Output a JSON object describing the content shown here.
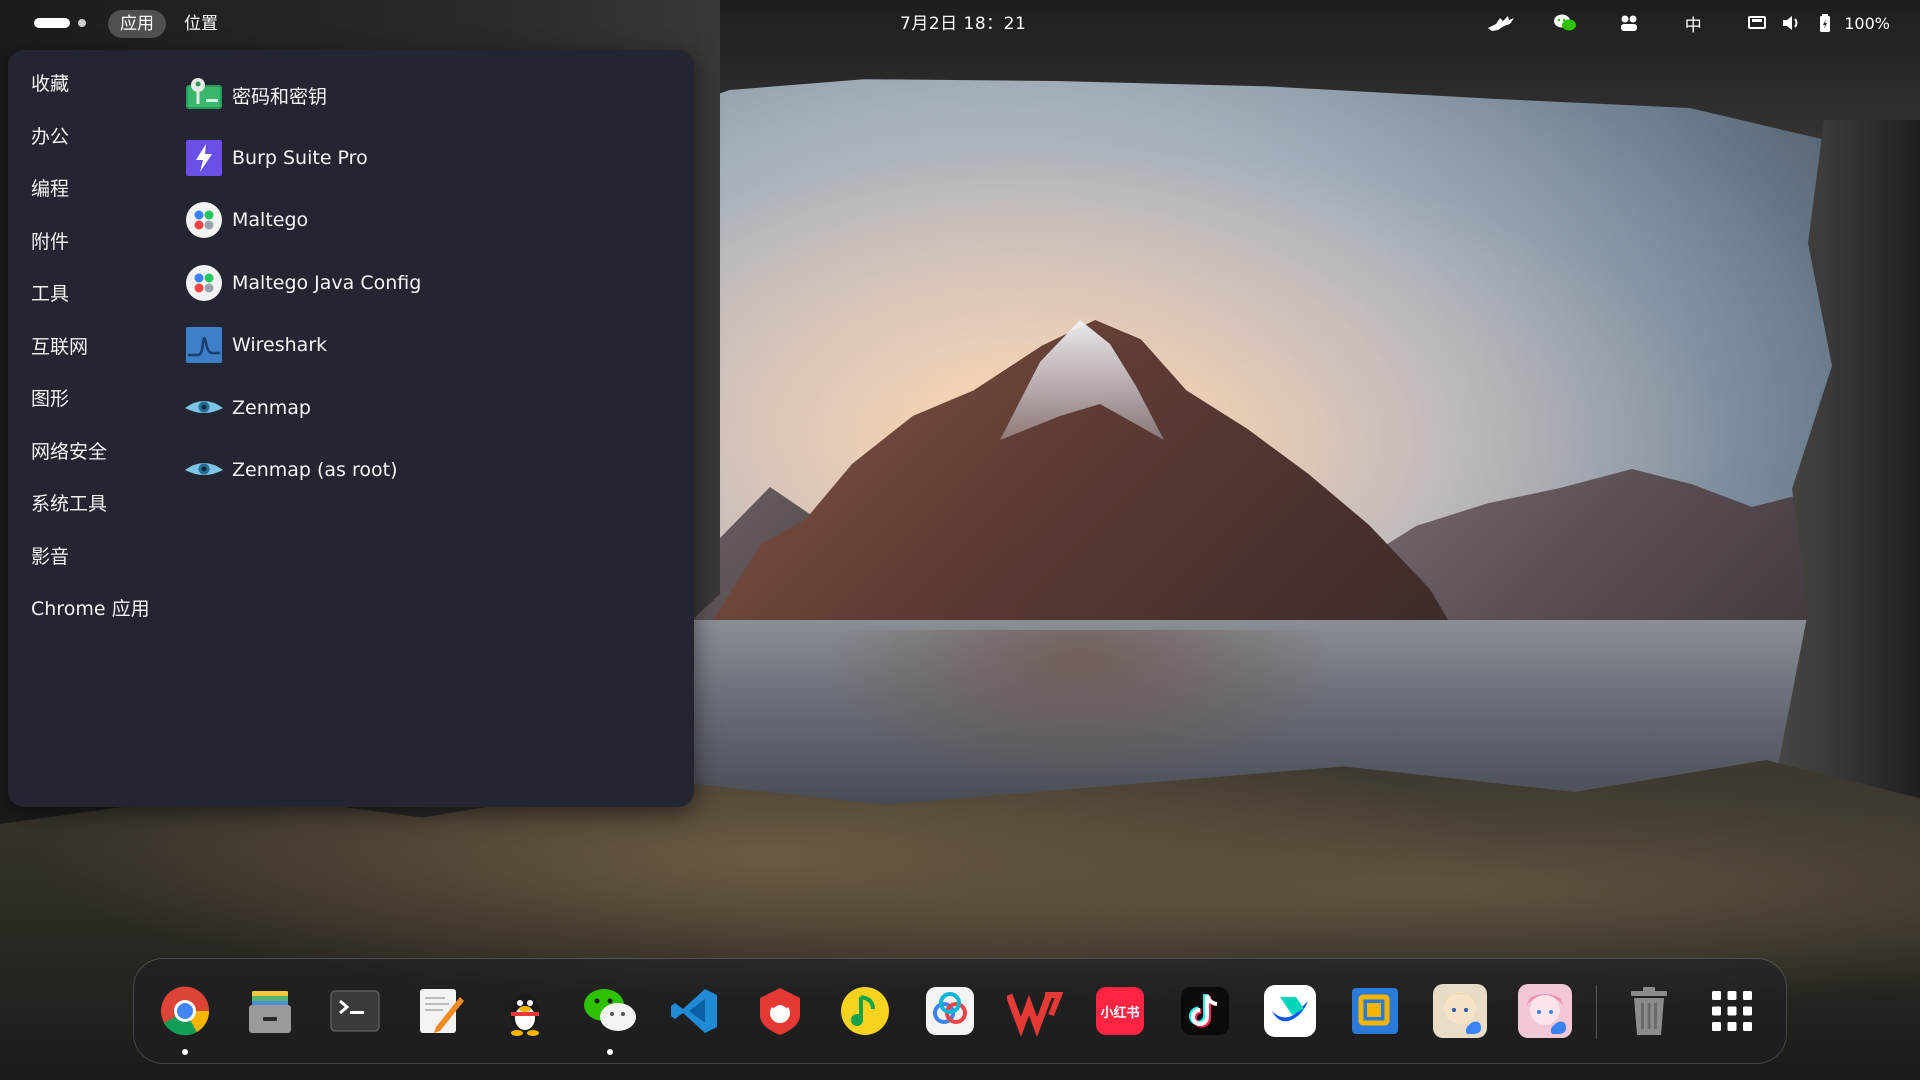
{
  "top_panel": {
    "apps_label": "应用",
    "places_label": "位置",
    "clock": "7月2日  18：21",
    "input_method": "中",
    "battery": "100%"
  },
  "menu": {
    "categories": [
      {
        "label": "收藏"
      },
      {
        "label": "办公"
      },
      {
        "label": "编程"
      },
      {
        "label": "附件"
      },
      {
        "label": "工具"
      },
      {
        "label": "互联网"
      },
      {
        "label": "图形"
      },
      {
        "label": "网络安全"
      },
      {
        "label": "系统工具"
      },
      {
        "label": "影音"
      },
      {
        "label": "Chrome 应用"
      }
    ],
    "apps": [
      {
        "label": "密码和密钥",
        "icon": "passwords-keys-icon"
      },
      {
        "label": "Burp Suite Pro",
        "icon": "burp-suite-icon"
      },
      {
        "label": "Maltego",
        "icon": "maltego-icon"
      },
      {
        "label": "Maltego Java Config",
        "icon": "maltego-icon"
      },
      {
        "label": "Wireshark",
        "icon": "wireshark-icon"
      },
      {
        "label": "Zenmap",
        "icon": "zenmap-eye-icon"
      },
      {
        "label": "Zenmap (as root)",
        "icon": "zenmap-eye-icon"
      }
    ]
  },
  "dock": {
    "items": [
      {
        "icon": "chrome-icon",
        "running": true
      },
      {
        "icon": "file-manager-icon",
        "running": false
      },
      {
        "icon": "terminal-icon",
        "running": false
      },
      {
        "icon": "text-editor-icon",
        "running": false
      },
      {
        "icon": "qq-penguin-icon",
        "running": false
      },
      {
        "icon": "wechat-icon",
        "running": true
      },
      {
        "icon": "vscode-icon",
        "running": false
      },
      {
        "icon": "red-shield-app-icon",
        "running": false
      },
      {
        "icon": "qq-music-icon",
        "running": false
      },
      {
        "icon": "baidu-netdisk-icon",
        "running": false
      },
      {
        "icon": "wps-office-icon",
        "running": false
      },
      {
        "icon": "xiaohongshu-icon",
        "running": false
      },
      {
        "icon": "tiktok-icon",
        "running": false
      },
      {
        "icon": "feishu-icon",
        "running": false
      },
      {
        "icon": "virtual-machine-icon",
        "running": false
      },
      {
        "icon": "genshin-cloud-icon",
        "running": false
      },
      {
        "icon": "honkai-cloud-icon",
        "running": false
      }
    ],
    "xiaohongshu_text": "小红书",
    "trash_icon": "trash-icon",
    "app_grid_icon": "app-grid-icon"
  },
  "colors": {
    "menu_bg": "#232631",
    "panel_text": "#ffffff",
    "active_pill": "#ffffff38"
  }
}
